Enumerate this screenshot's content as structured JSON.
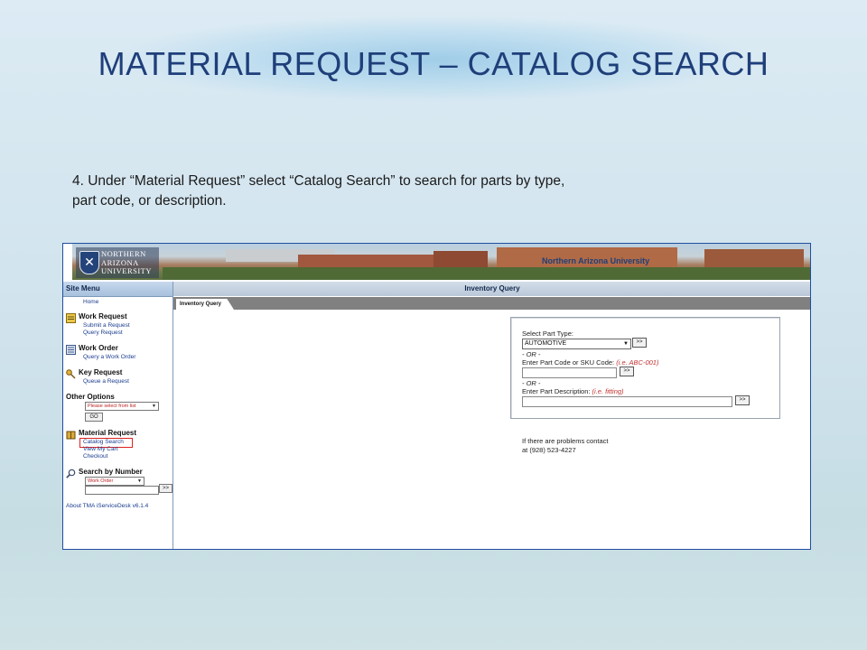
{
  "slide": {
    "title": "MATERIAL REQUEST – CATALOG SEARCH",
    "instruction": "4. Under “Material Request” select “Catalog Search” to search for parts by type, part code, or description."
  },
  "banner": {
    "logo_lines": [
      "NORTHERN",
      "ARIZONA",
      "UNIVERSITY"
    ],
    "site_name": "Northern Arizona University"
  },
  "sidebar": {
    "header": "Site Menu",
    "home": "Home",
    "work_request": {
      "title": "Work Request",
      "links": [
        "Submit a Request",
        "Query Request"
      ]
    },
    "work_order": {
      "title": "Work Order",
      "links": [
        "Query a Work Order"
      ]
    },
    "key_request": {
      "title": "Key Request",
      "links": [
        "Queue a Request"
      ]
    },
    "other_options": {
      "title": "Other Options",
      "select_value": "Please select from list",
      "go_label": "GO"
    },
    "material_request": {
      "title": "Material Request",
      "links": [
        "Catalog Search",
        "View My Cart",
        "Checkout"
      ]
    },
    "search_by_number": {
      "title": "Search by Number",
      "select_value": "Work Order",
      "go_label": ">>"
    },
    "about": "About TMA iServiceDesk v6.1.4"
  },
  "main": {
    "header": "Inventory Query",
    "tab": "Inventory Query",
    "form": {
      "part_type_label": "Select Part Type:",
      "part_type_value": "AUTOMOTIVE",
      "or_1": "- OR -",
      "code_label": "Enter Part Code or SKU Code:",
      "code_hint": "(i.e. ABC-001)",
      "or_2": "- OR -",
      "desc_label": "Enter Part Description:",
      "desc_hint": "(i.e. fitting)",
      "go_label": ">>"
    },
    "contact_line1": "If there are problems contact",
    "contact_line2": "at (928) 523-4227"
  },
  "colors": {
    "title": "#1f3f7a",
    "highlight": "#e02020",
    "link": "#1a3d8f"
  }
}
